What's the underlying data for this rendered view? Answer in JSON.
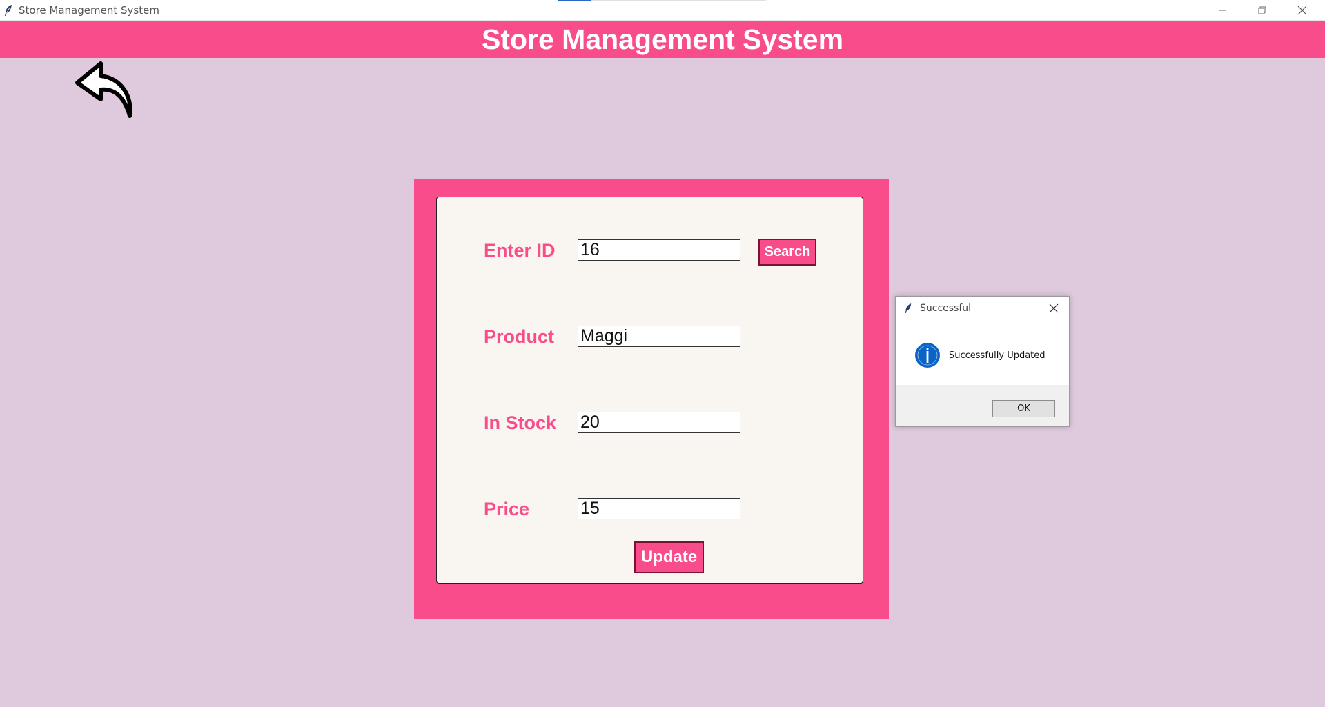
{
  "window": {
    "title": "Store Management System",
    "icon": "feather-icon",
    "controls": [
      "minimize-icon",
      "restore-icon",
      "close-icon"
    ],
    "progress_fraction": 0.16
  },
  "header": {
    "title": "Store Management System",
    "background_color": "#f84c8b"
  },
  "nav": {
    "back_icon": "back-arrow-icon"
  },
  "form": {
    "fields": [
      {
        "label": "Enter ID",
        "value": "16"
      },
      {
        "label": "Product",
        "value": "Maggi"
      },
      {
        "label": "In Stock",
        "value": "20"
      },
      {
        "label": "Price",
        "value": "15"
      }
    ],
    "search_label": "Search",
    "update_label": "Update"
  },
  "dialog": {
    "title": "Successful",
    "message": "Successfully Updated",
    "ok_label": "OK",
    "icon": "info-icon"
  },
  "colors": {
    "accent": "#f84c8b",
    "background": "#dfcadd",
    "card": "#f9f5f0",
    "info_blue": "#0a64c8"
  }
}
